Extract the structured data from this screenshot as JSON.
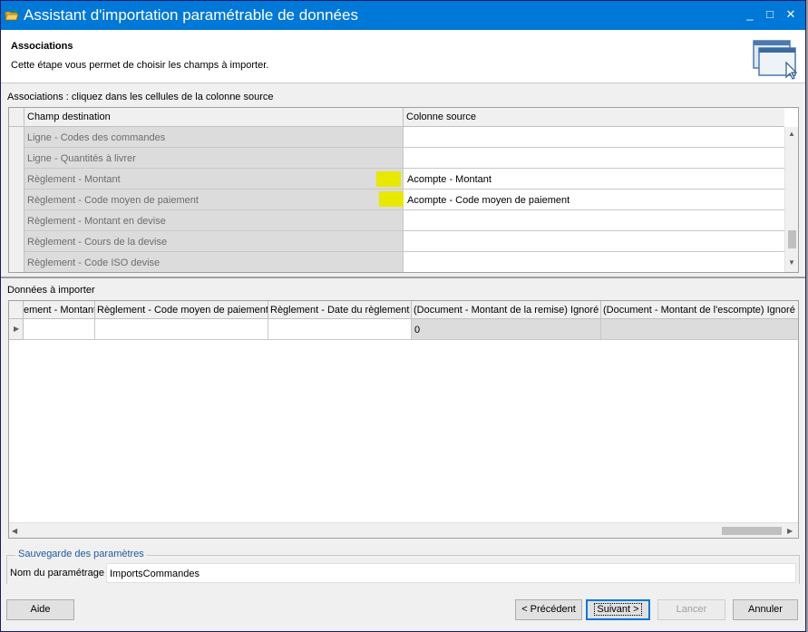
{
  "window": {
    "title": "Assistant d'importation paramétrable de données",
    "controls": {
      "minimize": "_",
      "maximize": "□",
      "close": "✕"
    }
  },
  "header": {
    "title": "Associations",
    "description": "Cette étape vous permet de choisir les champs à importer."
  },
  "associations": {
    "label": "Associations : cliquez dans les cellules de la colonne source",
    "columns": {
      "destination": "Champ destination",
      "source": "Colonne source"
    },
    "rows": [
      {
        "destination": "Ligne - Codes des commandes",
        "source": ""
      },
      {
        "destination": "Ligne - Quantités à livrer",
        "source": ""
      },
      {
        "destination": "Règlement - Montant",
        "source": "Acompte - Montant"
      },
      {
        "destination": "Règlement - Code moyen de paiement",
        "source": "Acompte - Code moyen de paiement"
      },
      {
        "destination": "Règlement - Montant en devise",
        "source": ""
      },
      {
        "destination": "Règlement - Cours de la devise",
        "source": ""
      },
      {
        "destination": "Règlement - Code ISO devise",
        "source": ""
      }
    ],
    "highlight_color": "#e8e800"
  },
  "donnees": {
    "label": "Données à importer",
    "columns": [
      "ement - Montant",
      "Règlement - Code moyen de paiement",
      "Règlement - Date du règlement",
      "(Document - Montant de la remise) Ignoré",
      "(Document - Montant de l'escompte) Ignoré"
    ],
    "row": [
      "",
      "",
      "",
      "0",
      ""
    ]
  },
  "sauvegarde": {
    "legend": "Sauvegarde des paramètres",
    "name_label": "Nom du paramétrage",
    "name_value": "ImportsCommandes"
  },
  "buttons": {
    "aide": "Aide",
    "precedent": "< Précédent",
    "suivant": "Suivant >",
    "lancer": "Lancer",
    "annuler": "Annuler"
  },
  "colors": {
    "titlebar": "#0078d7",
    "legend_text": "#1e5aa0"
  }
}
